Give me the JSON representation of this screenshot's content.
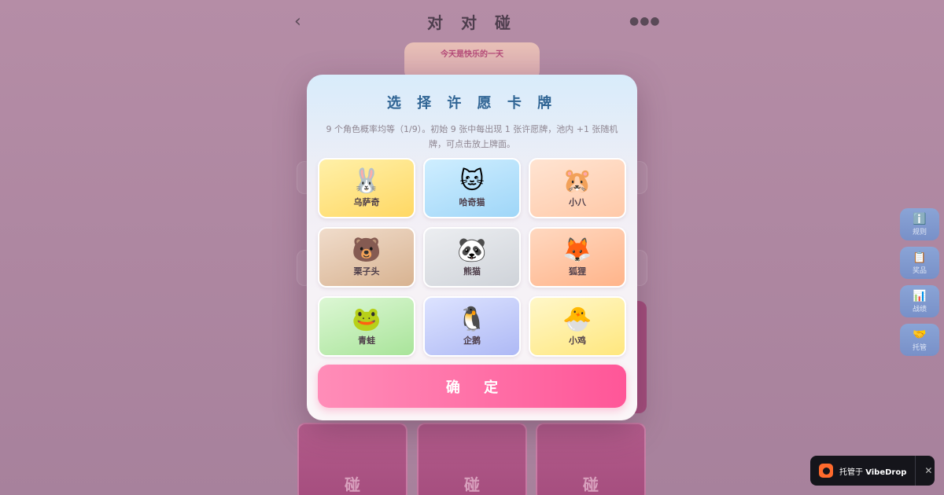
{
  "header": {
    "back_icon": "chevron-left-icon",
    "back_glyph": "‹",
    "title": "对 对 碰",
    "more_icon": "more-horizontal-icon",
    "more_glyph": "●●●"
  },
  "banner": {
    "text": "今天是快乐的一天"
  },
  "board": {
    "cards": [
      {
        "label": "碰"
      },
      {
        "label": "碰"
      },
      {
        "label": "碰"
      }
    ]
  },
  "side_panel": [
    {
      "icon": "info-icon",
      "glyph": "ℹ️",
      "label": "规则"
    },
    {
      "icon": "clipboard-icon",
      "glyph": "📋",
      "label": "奖品"
    },
    {
      "icon": "bar-chart-icon",
      "glyph": "📊",
      "label": "战绩"
    },
    {
      "icon": "handshake-icon",
      "glyph": "🤝",
      "label": "托管"
    }
  ],
  "vibedrop": {
    "prefix": "托管于 ",
    "brand": "VibeDrop",
    "close_glyph": "✕"
  },
  "modal": {
    "title": "选 择 许 愿 卡 牌",
    "description": "9 个角色概率均等（1/9）。初始 9 张中每出现 1 张许愿牌，池内 +1 张随机牌，可点击放上牌面。",
    "cards": [
      {
        "name": "乌萨奇",
        "emoji": "🐰",
        "icon": "rabbit-icon",
        "color_start": "#fff0a8",
        "color_end": "#ffd864"
      },
      {
        "name": "哈奇猫",
        "emoji": "🐱",
        "icon": "cat-icon",
        "color_start": "#cfeeff",
        "color_end": "#9fd6f8"
      },
      {
        "name": "小八",
        "emoji": "🐹",
        "icon": "hamster-icon",
        "color_start": "#ffe4d2",
        "color_end": "#ffc9a8"
      },
      {
        "name": "栗子头",
        "emoji": "🐻",
        "icon": "bear-icon",
        "color_start": "#f0dccb",
        "color_end": "#d8b391"
      },
      {
        "name": "熊猫",
        "emoji": "🐼",
        "icon": "panda-icon",
        "color_start": "#eceef1",
        "color_end": "#cfd3d9"
      },
      {
        "name": "狐狸",
        "emoji": "🦊",
        "icon": "fox-icon",
        "color_start": "#ffd8c0",
        "color_end": "#ffb48a"
      },
      {
        "name": "青蛙",
        "emoji": "🐸",
        "icon": "frog-icon",
        "color_start": "#dcf7d4",
        "color_end": "#a9e49a"
      },
      {
        "name": "企鹅",
        "emoji": "🐧",
        "icon": "penguin-icon",
        "color_start": "#dde3ff",
        "color_end": "#aeb9f5"
      },
      {
        "name": "小鸡",
        "emoji": "🐣",
        "icon": "chick-icon",
        "color_start": "#fff7c8",
        "color_end": "#ffe77e"
      }
    ],
    "confirm_label": "确 定"
  }
}
